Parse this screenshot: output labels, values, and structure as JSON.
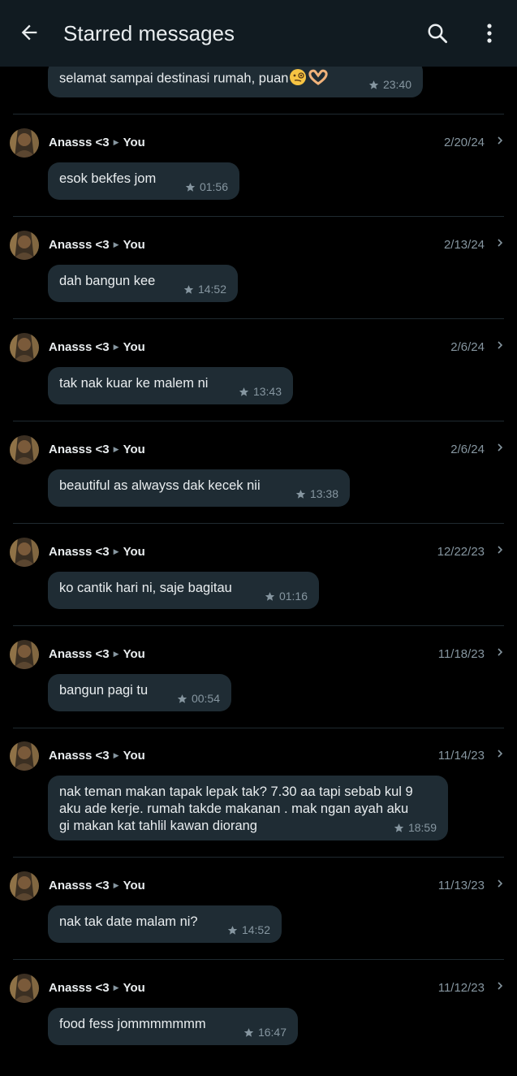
{
  "appbar": {
    "title": "Starred messages",
    "icons": [
      "back-arrow-icon",
      "search-icon",
      "more-vert-icon"
    ]
  },
  "messages": [
    {
      "sender": "",
      "recipient": "",
      "date": "",
      "text": "selamat sampai destinasi rumah, puan",
      "emoji": [
        "face-with-monocle",
        "heart-hands"
      ],
      "time": "23:40"
    },
    {
      "sender": "Anasss <3",
      "recipient": "You",
      "date": "2/20/24",
      "text": "esok bekfes jom",
      "time": "01:56"
    },
    {
      "sender": "Anasss <3",
      "recipient": "You",
      "date": "2/13/24",
      "text": "dah bangun kee",
      "time": "14:52"
    },
    {
      "sender": "Anasss <3",
      "recipient": "You",
      "date": "2/6/24",
      "text": "tak nak kuar ke malem ni",
      "time": "13:43"
    },
    {
      "sender": "Anasss <3",
      "recipient": "You",
      "date": "2/6/24",
      "text": "beautiful as alwayss dak kecek nii",
      "time": "13:38"
    },
    {
      "sender": "Anasss <3",
      "recipient": "You",
      "date": "12/22/23",
      "text": "ko cantik hari ni, saje bagitau",
      "time": "01:16"
    },
    {
      "sender": "Anasss <3",
      "recipient": "You",
      "date": "11/18/23",
      "text": "bangun pagi tu",
      "time": "00:54"
    },
    {
      "sender": "Anasss <3",
      "recipient": "You",
      "date": "11/14/23",
      "text": "nak teman makan tapak lepak tak? 7.30 aa tapi sebab kul 9\naku ade kerje. rumah takde makanan . mak ngan ayah aku\ngi makan kat tahlil kawan diorang",
      "time": "18:59"
    },
    {
      "sender": "Anasss <3",
      "recipient": "You",
      "date": "11/13/23",
      "text": "nak tak date malam ni?",
      "time": "14:52"
    },
    {
      "sender": "Anasss <3",
      "recipient": "You",
      "date": "11/12/23",
      "text": "food fess jommmmmmm",
      "time": "16:47"
    }
  ],
  "colors": {
    "background": "#000000",
    "appbar": "#111b21",
    "bubble": "#1f2c34",
    "text": "#e9edef",
    "muted": "#8696a0"
  }
}
